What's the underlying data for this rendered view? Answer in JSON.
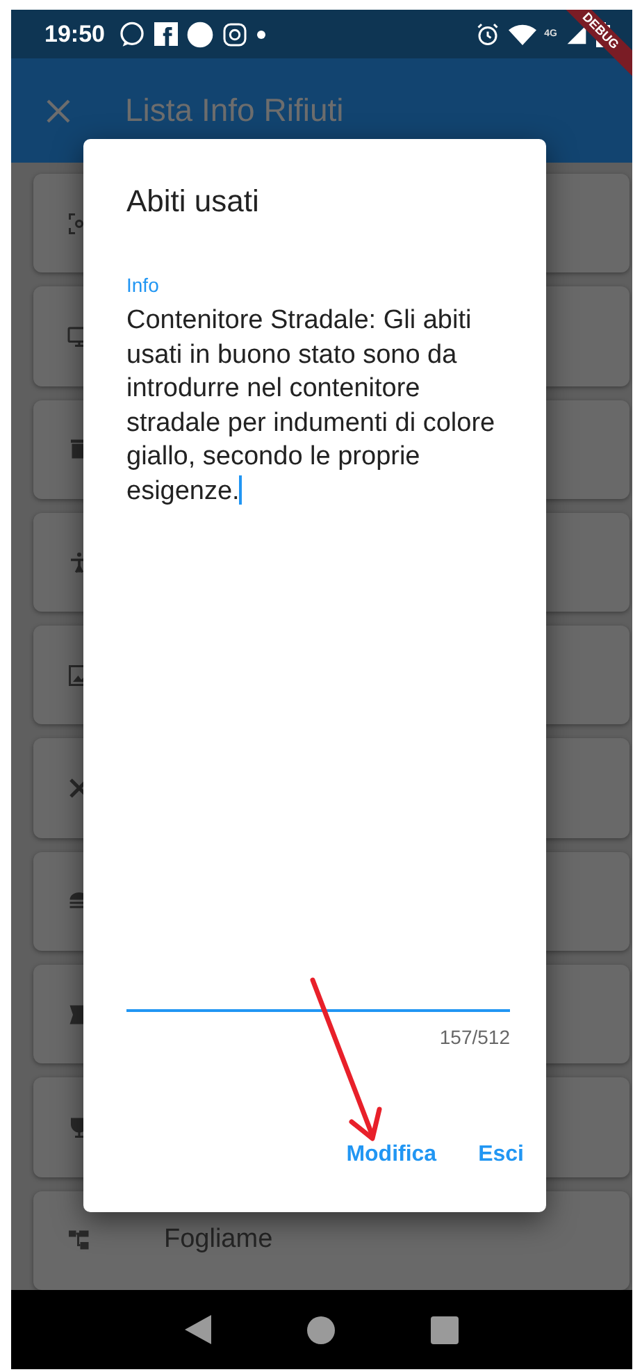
{
  "status_bar": {
    "time": "19:50",
    "network": "4G"
  },
  "debug_banner": "DEBUG",
  "app_bar": {
    "title": "Lista Info Rifiuti"
  },
  "list": {
    "items": [
      {
        "kind": "scan"
      },
      {
        "kind": "monitor"
      },
      {
        "kind": "bin"
      },
      {
        "kind": "person"
      },
      {
        "kind": "picture"
      },
      {
        "kind": "tools"
      },
      {
        "kind": "burger"
      },
      {
        "kind": "ribbon"
      },
      {
        "kind": "cup"
      },
      {
        "kind": "tree",
        "label": "Fogliame"
      }
    ]
  },
  "dialog": {
    "title": "Abiti usati",
    "field": {
      "label": "Info",
      "value": "Contenitore Stradale: Gli abiti usati in buono stato sono da introdurre nel contenitore stradale per indumenti di colore giallo, secondo le proprie esigenze.",
      "counter": "157/512"
    },
    "buttons": [
      {
        "label": "Modifica"
      },
      {
        "label": "Esci"
      }
    ]
  }
}
